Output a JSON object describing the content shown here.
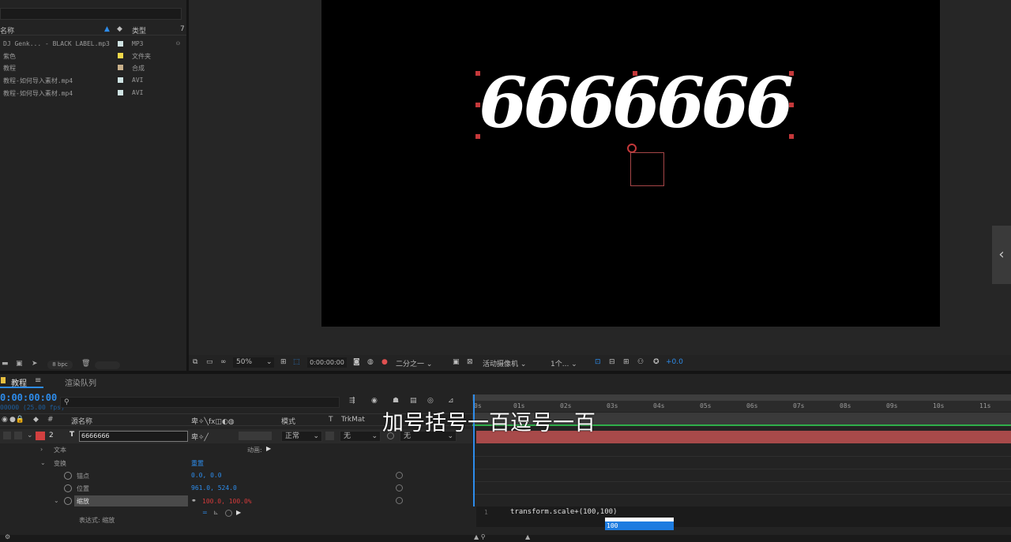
{
  "project": {
    "col_name": "名称",
    "col_type": "类型",
    "items": [
      {
        "name": "DJ Genk... - BLACK LABEL.mp3",
        "type": "MP3",
        "color": "#cfe3e3"
      },
      {
        "name": "紫色",
        "type": "文件夹",
        "color": "#f0d84a"
      },
      {
        "name": "教程",
        "type": "合成",
        "color": "#c9b08a"
      },
      {
        "name": "教程-如何导入素材.mp4",
        "type": "AVI",
        "color": "#cfe3e3"
      },
      {
        "name": "教程-如何导入素材.mp4",
        "type": "AVI",
        "color": "#cfe3e3"
      }
    ],
    "bpc": "8 bpc"
  },
  "viewer": {
    "text": "6666666",
    "zoom": "50%",
    "time": "0:00:00:00",
    "resolution": "二分之一",
    "camera": "活动摄像机",
    "views": "1个...",
    "exposure": "+0.0"
  },
  "timeline": {
    "tab_comp": "教程",
    "tab_render": "渲染队列",
    "timecode": "0:00:00:00",
    "fps": "00000 (25.00 fps)",
    "header": {
      "source_name": "源名称",
      "mode": "模式",
      "trkmat": "TrkMat",
      "t": "T"
    },
    "layer": {
      "index": "2",
      "name": "6666666",
      "mode": "正常",
      "trkmat": "无",
      "parent": "无"
    },
    "props": {
      "text": "文本",
      "animate": "动画:",
      "transform": "变换",
      "reset": "重置",
      "anchor": "锚点",
      "anchor_val": "0.0, 0.0",
      "position": "位置",
      "position_val": "961.0, 524.0",
      "scale": "缩放",
      "scale_val": "100.0, 100.0%",
      "expression_label": "表达式: 缩放"
    },
    "ruler": [
      "0s",
      "01s",
      "02s",
      "03s",
      "04s",
      "05s",
      "06s",
      "07s",
      "08s",
      "09s",
      "10s",
      "11s"
    ],
    "expression": {
      "line": "1",
      "code": "transform.scale+(100,100)",
      "suggestion": "100"
    }
  },
  "subtitle": "加号括号一百逗号一百"
}
